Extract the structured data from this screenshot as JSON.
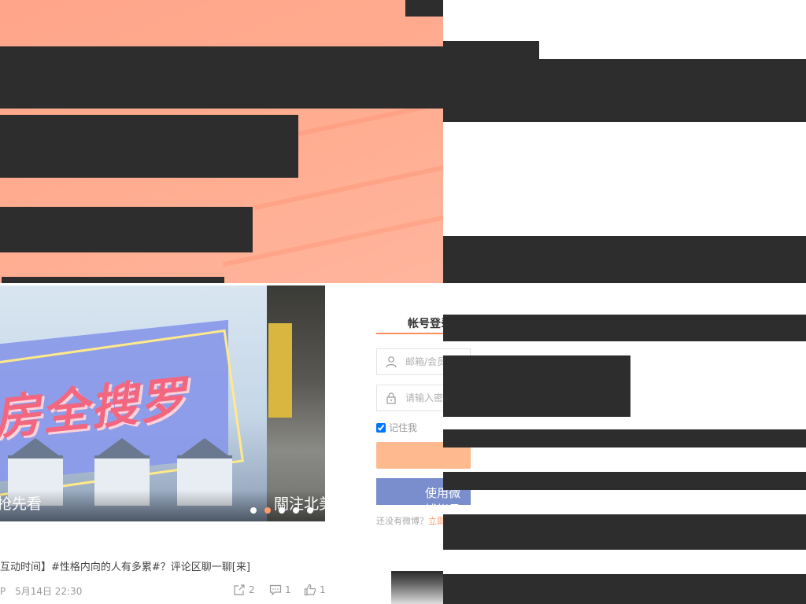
{
  "slideshow": {
    "headline": "房全搜罗",
    "caption_main": "抢先看",
    "caption_side": "關注北美",
    "active_dot": 2,
    "dot_count": 5
  },
  "login": {
    "tab_label": "帐号登录",
    "email_placeholder": "邮箱/会员帐号",
    "password_placeholder": "请输入密码",
    "remember_label": "记住我",
    "remember_checked": true,
    "login_button": "",
    "weibo_button": "使用微博帐号登录",
    "signup_prompt": "还没有微博？",
    "signup_link": "立即注册"
  },
  "feed": {
    "post_title": "互动时间】#性格内向的人有多累#？评论区聊一聊[来]",
    "post_author": "P",
    "post_time": "5月14日 22:30",
    "reposts": "2",
    "comments": "1",
    "likes": "1"
  },
  "colors": {
    "banner": "#ffa58a",
    "accent": "#ff8f5a",
    "weibo_blue": "#7a8ecd",
    "redaction": "#2d2d2d"
  }
}
